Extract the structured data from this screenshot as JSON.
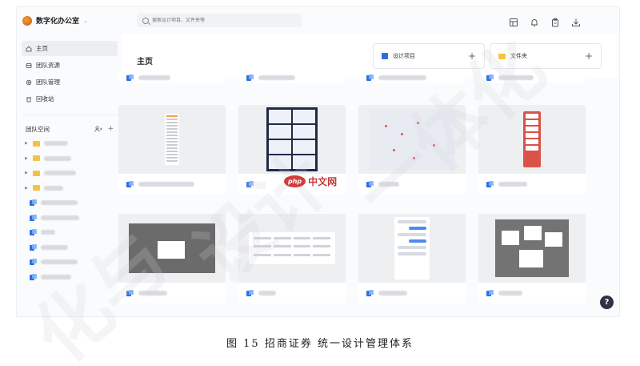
{
  "workspace": {
    "name": "数字化办公室",
    "chevron": "⌄"
  },
  "search": {
    "placeholder": "搜索设计项目、文件夹等"
  },
  "top_icons": [
    "layout-icon",
    "bell-icon",
    "clipboard-icon",
    "download-icon"
  ],
  "sidebar": {
    "nav": [
      {
        "label": "主页",
        "icon": "home-icon",
        "active": true
      },
      {
        "label": "团队资源",
        "icon": "resource-icon",
        "active": false
      },
      {
        "label": "团队管理",
        "icon": "settings-icon",
        "active": false
      },
      {
        "label": "回收站",
        "icon": "trash-icon",
        "active": false
      }
    ],
    "team_space_label": "团队空间",
    "team_add": "+"
  },
  "main": {
    "title": "主页",
    "create_project": {
      "label": "设计项目",
      "plus": "+"
    },
    "create_folder": {
      "label": "文件夹",
      "plus": "+"
    }
  },
  "help": {
    "label": "?"
  },
  "watermark": {
    "php_logo": "php",
    "php_text": "中文网"
  },
  "caption": "图 15 招商证券 统一设计管理体系",
  "colors": {
    "accent": "#2f6fe0",
    "folder": "#f6c242",
    "help_bg": "#2d3340"
  }
}
